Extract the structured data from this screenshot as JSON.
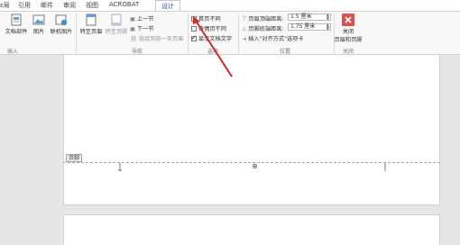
{
  "tabs": [
    "ɛ局",
    "引用",
    "邮件",
    "审阅",
    "视图",
    "ACROBAT",
    "设计"
  ],
  "ribbon": {
    "insert": {
      "doc_parts": "文档部件",
      "picture": "图片",
      "online_picture": "联机图片",
      "group": "插入"
    },
    "nav": {
      "goto_header": "转至页眉",
      "goto_footer": "转至页脚",
      "prev": "上一节",
      "next": "下一节",
      "link_prev": "链接到前一条页眉",
      "group": "导航"
    },
    "options": {
      "first_page": "首页不同",
      "odd_even": "奇偶页不同",
      "show_text": "显示文档文字",
      "group": "选项"
    },
    "position": {
      "header_top_label": "页眉顶端距离:",
      "header_top_value": "1.5 厘米",
      "footer_bottom_label": "页脚底端距离:",
      "footer_bottom_value": "1.75 厘米",
      "insert_tab": "插入\"对齐方式\"选项卡",
      "group": "位置"
    },
    "close": {
      "label1": "关闭",
      "label2": "页眉和页脚",
      "group": "关闭"
    }
  },
  "document": {
    "footer_tag": "页脚"
  },
  "colors": {
    "accent": "#2b579a",
    "close_red": "#d9534f",
    "arrow": "#c8322b"
  }
}
